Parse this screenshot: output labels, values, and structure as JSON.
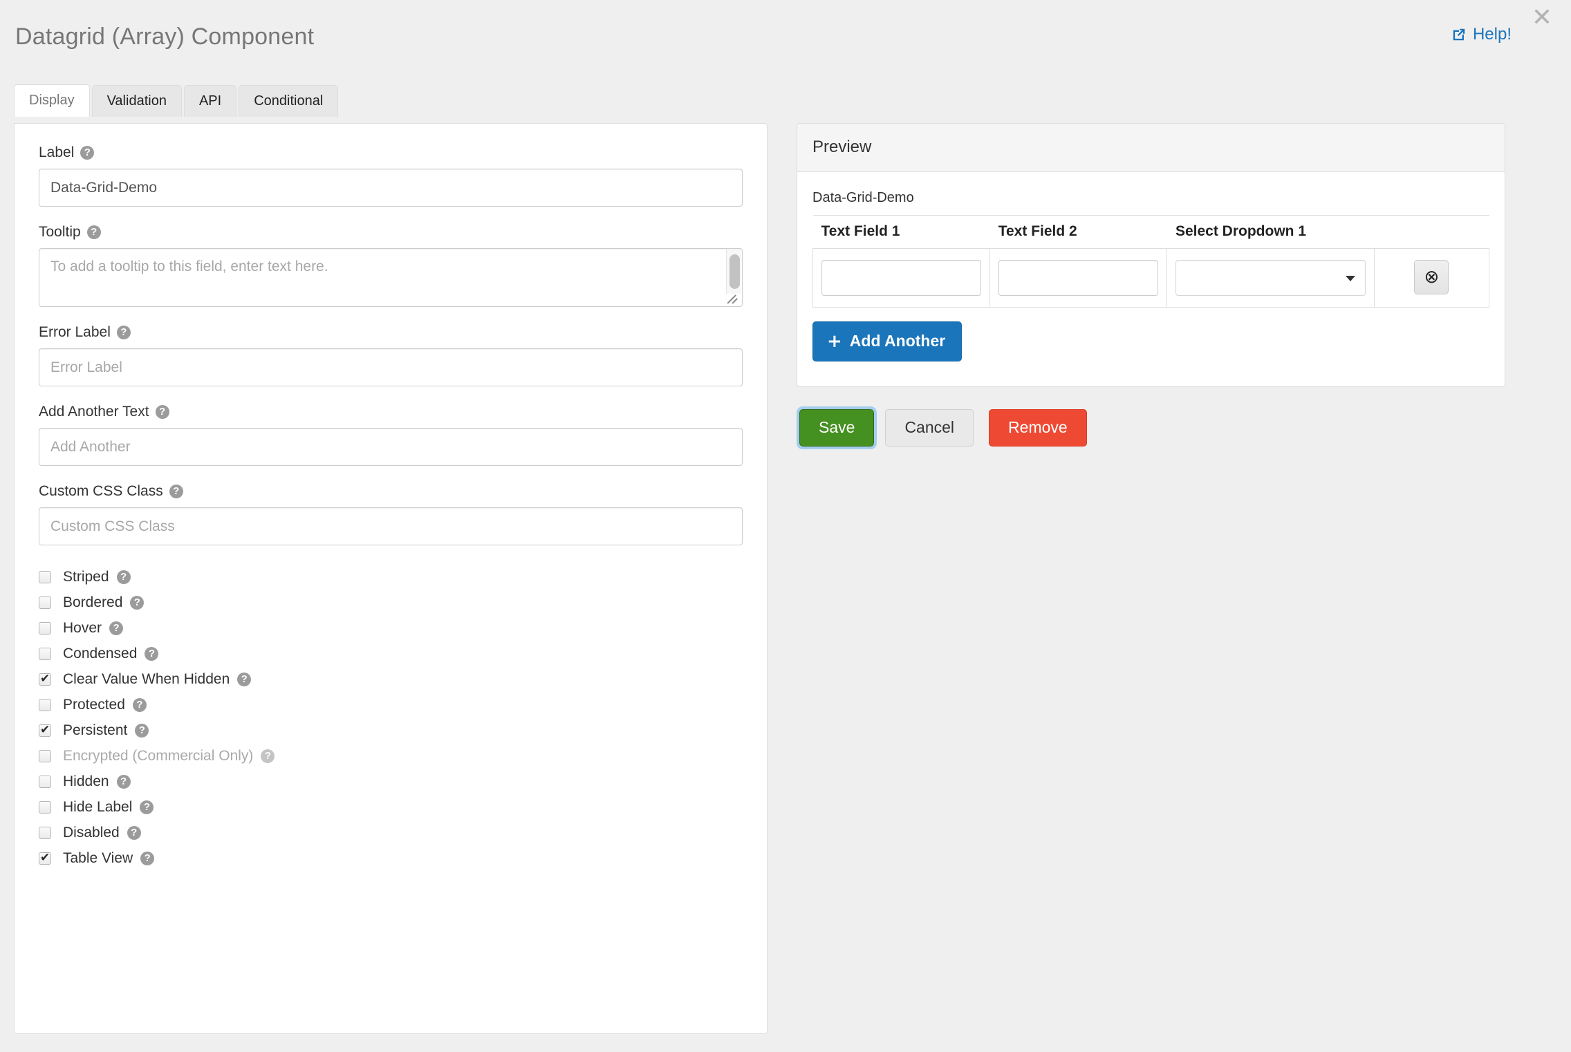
{
  "header": {
    "title": "Datagrid (Array) Component",
    "help_label": "Help!",
    "help_icon": "external-link-icon",
    "close_icon": "close-icon"
  },
  "tabs": [
    {
      "label": "Display",
      "active": true
    },
    {
      "label": "Validation",
      "active": false
    },
    {
      "label": "API",
      "active": false
    },
    {
      "label": "Conditional",
      "active": false
    }
  ],
  "form": {
    "help_icon": "question-circle-icon",
    "fields": [
      {
        "label": "Label",
        "value": "Data-Grid-Demo",
        "placeholder": "",
        "type": "text"
      },
      {
        "label": "Tooltip",
        "value": "",
        "placeholder": "To add a tooltip to this field, enter text here.",
        "type": "textarea"
      },
      {
        "label": "Error Label",
        "value": "",
        "placeholder": "Error Label",
        "type": "text"
      },
      {
        "label": "Add Another Text",
        "value": "",
        "placeholder": "Add Another",
        "type": "text"
      },
      {
        "label": "Custom CSS Class",
        "value": "",
        "placeholder": "Custom CSS Class",
        "type": "text"
      }
    ],
    "checkboxes": [
      {
        "label": "Striped",
        "checked": false,
        "disabled": false
      },
      {
        "label": "Bordered",
        "checked": false,
        "disabled": false
      },
      {
        "label": "Hover",
        "checked": false,
        "disabled": false
      },
      {
        "label": "Condensed",
        "checked": false,
        "disabled": false
      },
      {
        "label": "Clear Value When Hidden",
        "checked": true,
        "disabled": false
      },
      {
        "label": "Protected",
        "checked": false,
        "disabled": false
      },
      {
        "label": "Persistent",
        "checked": true,
        "disabled": false
      },
      {
        "label": "Encrypted (Commercial Only)",
        "checked": false,
        "disabled": true
      },
      {
        "label": "Hidden",
        "checked": false,
        "disabled": false
      },
      {
        "label": "Hide Label",
        "checked": false,
        "disabled": false
      },
      {
        "label": "Disabled",
        "checked": false,
        "disabled": false
      },
      {
        "label": "Table View",
        "checked": true,
        "disabled": false
      }
    ]
  },
  "preview": {
    "title": "Preview",
    "datagrid_label": "Data-Grid-Demo",
    "columns": [
      "Text Field 1",
      "Text Field 2",
      "Select Dropdown 1"
    ],
    "row": {
      "text_field_1": "",
      "text_field_2": "",
      "select_dropdown_1": "",
      "remove_icon": "remove-circle-icon"
    },
    "add_another_label": "Add Another",
    "add_another_icon": "plus-icon"
  },
  "actions": {
    "save_label": "Save",
    "cancel_label": "Cancel",
    "remove_label": "Remove"
  },
  "colors": {
    "accent_blue": "#1b75bb",
    "save_green": "#449020",
    "remove_red": "#ee4a33",
    "page_bg": "#efefef",
    "focus_ring": "#a4cdee"
  }
}
